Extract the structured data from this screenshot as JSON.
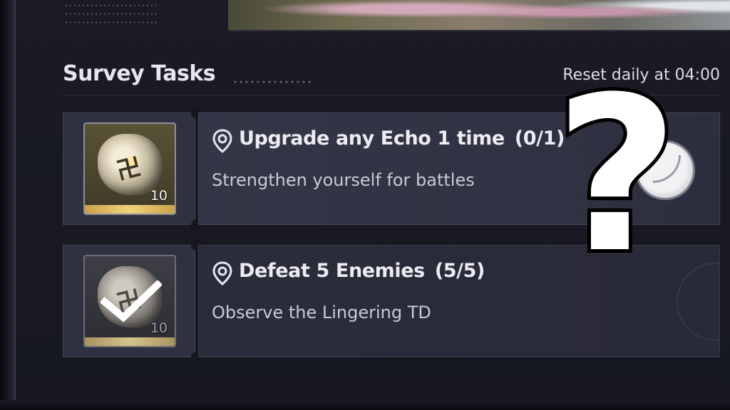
{
  "header": {
    "title": "Survey Tasks",
    "reset_text": "Reset daily at 04:00"
  },
  "tasks": [
    {
      "title": "Upgrade any Echo 1 time",
      "progress": "(0/1)",
      "description": "Strengthen yourself for battles",
      "reward_count": "10",
      "completed": false
    },
    {
      "title": "Defeat 5 Enemies",
      "progress": "(5/5)",
      "description": "Observe the Lingering TD",
      "reward_count": "10",
      "completed": true
    }
  ],
  "overlay": {
    "symbol": "?"
  },
  "colors": {
    "panel_bg": "#16171f",
    "card_bg": "#343647",
    "text_primary": "#ececf2",
    "reward_gold": "#f0d27a"
  }
}
